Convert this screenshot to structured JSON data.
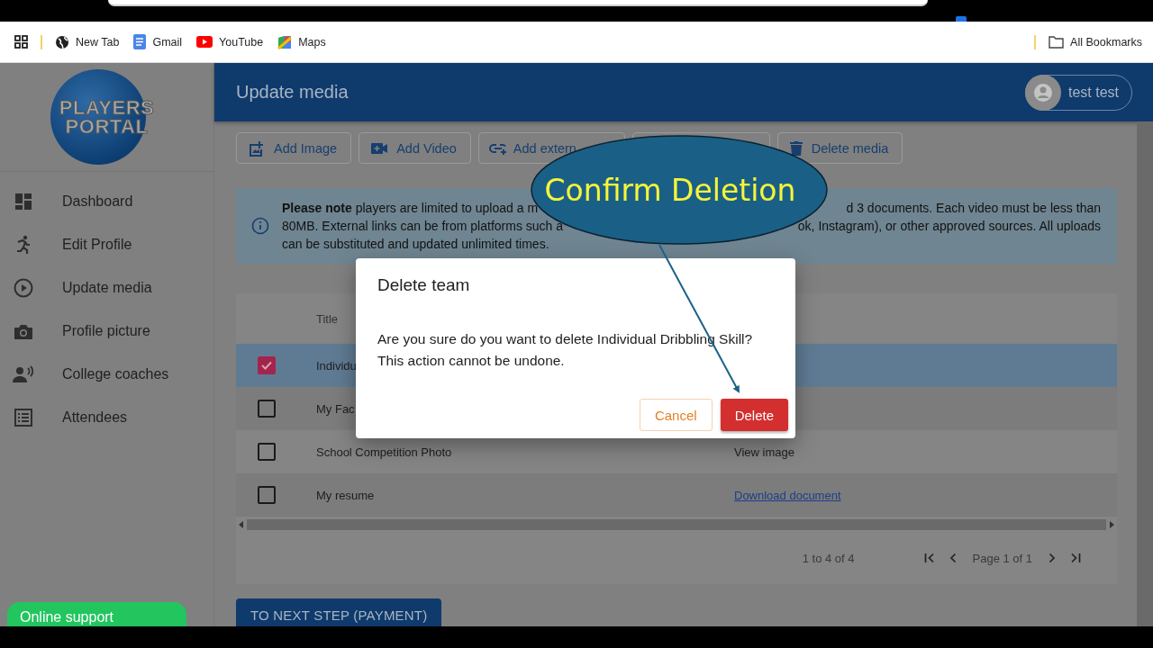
{
  "browser": {
    "bookmarks": [
      {
        "label": "New Tab"
      },
      {
        "label": "Gmail"
      },
      {
        "label": "YouTube"
      },
      {
        "label": "Maps"
      }
    ],
    "all_bookmarks": "All Bookmarks"
  },
  "sidebar": {
    "logo": [
      "PLAYERS",
      "PORTAL"
    ],
    "items": [
      {
        "label": "Dashboard"
      },
      {
        "label": "Edit Profile"
      },
      {
        "label": "Update media"
      },
      {
        "label": "Profile picture"
      },
      {
        "label": "College coaches"
      },
      {
        "label": "Attendees"
      }
    ],
    "support": "Online support"
  },
  "header": {
    "title": "Update media",
    "user": "test test"
  },
  "toolbar": [
    {
      "kind": "button",
      "label": "Add Image"
    },
    {
      "kind": "button",
      "label": "Add Video"
    },
    {
      "kind": "button",
      "label": "Add extern"
    },
    {
      "kind": "covered"
    },
    {
      "kind": "button",
      "label": "Delete media"
    }
  ],
  "notice": {
    "lines": [
      {
        "left": "**Please note** players are limited to upload a m",
        "right": "d 3 documents. Each video must be less than"
      },
      {
        "left": "80MB. External links can be from platforms such a",
        "right": "ok, Instagram), or other approved sources. All uploads"
      },
      {
        "left": "can be substituted and updated unlimited times."
      }
    ]
  },
  "table": {
    "columns": [
      "Title"
    ],
    "rows": [
      {
        "title": "Individu",
        "checked": true,
        "selected": true
      },
      {
        "title": "My Fac",
        "checked": false,
        "selected": false
      },
      {
        "title": "School Competition Photo",
        "media": "View image",
        "kind": "text",
        "checked": false,
        "selected": false
      },
      {
        "title": "My resume",
        "media": "Download document",
        "kind": "link",
        "checked": false,
        "selected": false
      }
    ]
  },
  "pagination": {
    "range": "1 to 4 of 4",
    "page": "Page 1 of 1"
  },
  "next_button": "TO NEXT STEP (PAYMENT)",
  "dialog": {
    "title": "Delete team",
    "message": [
      "Are you sure do you want to delete Individual Dribbling Skill?",
      "This action cannot be undone."
    ],
    "buttons": [
      {
        "label": "Cancel",
        "kind": "secondary"
      },
      {
        "label": "Delete",
        "kind": "danger"
      }
    ]
  },
  "callout": {
    "text": "Confirm Deletion"
  }
}
